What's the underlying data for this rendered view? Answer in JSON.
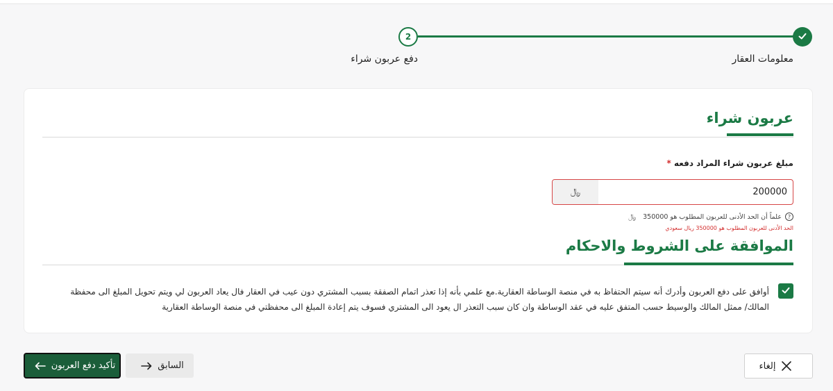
{
  "stepper": {
    "steps": [
      {
        "label": "معلومات العقار",
        "number": "",
        "status": "completed"
      },
      {
        "label": "دفع عربون شراء",
        "number": "2",
        "status": "current"
      }
    ]
  },
  "deposit": {
    "section_title": "عربون شراء",
    "field_label": "مبلغ عربون شراء المراد دفعه",
    "required_mark": "*",
    "amount_value": "200000",
    "currency_symbol": "﷼",
    "hint": "علماً أن الحد الأدنى للعربون المطلوب هو 350000",
    "error": "الحد الأدنى للعربون المطلوب هو 350000 ريال سعودي"
  },
  "terms": {
    "section_title": "الموافقة على الشروط والاحكام",
    "checked": true,
    "text": "أوافق على دفع العربون وأدرك أنه سيتم الحتفاظ به في منصة الوساطة العقارية.مع علمي بأنه إذا تعذر اتمام الصفقة بسبب المشتري دون عيب في العقار فال يعاد العربون لي ويتم تحويل المبلغ الى محفظة المالك/ ممثل المالك والوسيط حسب المتفق عليه في عقد الوساطة وان كان سبب التعذر ال يعود الى المشتري فسوف يتم إعادة المبلغ الى محفظتي في منصة الوساطة العقارية"
  },
  "actions": {
    "confirm_label": "تأكيد دفع العربون",
    "previous_label": "السابق",
    "cancel_label": "إلغاء"
  },
  "colors": {
    "primary": "#1b7a45",
    "confirm_bg": "#1b5e3a",
    "error": "#d32f2f"
  },
  "icons": {
    "step_done": "check-icon",
    "hint": "question-circle-icon",
    "confirm": "arrow-left-icon",
    "previous": "arrow-right-icon",
    "cancel": "close-icon"
  }
}
